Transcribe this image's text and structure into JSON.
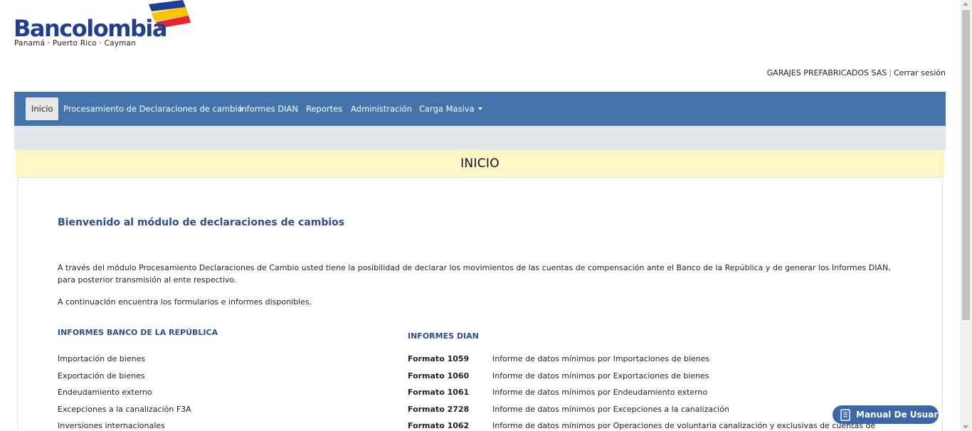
{
  "brand": {
    "name": "Bancolombia",
    "subtitle": "Panamá · Puerto Rico · Cayman",
    "colors": {
      "blue": "#1f3f8f",
      "yellow": "#f7c600",
      "red": "#e4262f"
    }
  },
  "userbar": {
    "company": "GARAJES PREFABRICADOS SAS",
    "separator": "|",
    "logout": "Cerrar sesión"
  },
  "nav": {
    "items": [
      {
        "label": "Inicio",
        "active": true
      },
      {
        "label": "Procesamiento de Declaraciones de cambio"
      },
      {
        "label": "Informes DIAN"
      },
      {
        "label": "Reportes"
      },
      {
        "label": "Administración"
      },
      {
        "label": "Carga Masiva",
        "dropdown": true
      }
    ],
    "color": "#4374ab"
  },
  "page": {
    "heading": "INICIO",
    "welcome": "Bienvenido al módulo de declaraciones de cambios",
    "intro": "A través del módulo Procesamiento Declaraciones de Cambio usted tiene la posibilidad de declarar los movimientos de las cuentas de compensación ante el Banco de la República y de generar los Informes DIAN, para posterior transmisión al ente respectivo.",
    "intro2": "A continuación encuentra los formularios e informes disponibles."
  },
  "informes_banco": {
    "title": "INFORMES BANCO DE LA REPÚBLICA",
    "items": [
      "Importación de bienes",
      "Exportación de bienes",
      "Endeudamiento externo",
      "Excepciones a la canalización F3A",
      "Inversiones internacionales"
    ]
  },
  "informes_dian": {
    "title": "INFORMES DIAN",
    "items": [
      {
        "format": "Formato 1059",
        "desc": "Informe de datos mínimos por Importaciones de bienes"
      },
      {
        "format": "Formato 1060",
        "desc": "Informe de datos mínimos por Exportaciones de bienes"
      },
      {
        "format": "Formato 1061",
        "desc": "Informe de datos mínimos por Endeudamiento externo"
      },
      {
        "format": "Formato 2728",
        "desc": "Informe de datos mínimos por Excepciones a la canalización"
      },
      {
        "format": "Formato 1062",
        "desc": "Informe de datos mínimos por Operaciones de voluntaria canalización y exclusivas de cuentas de"
      }
    ]
  },
  "manual_button": {
    "label": "Manual De Usuario",
    "icon": "document-icon"
  }
}
